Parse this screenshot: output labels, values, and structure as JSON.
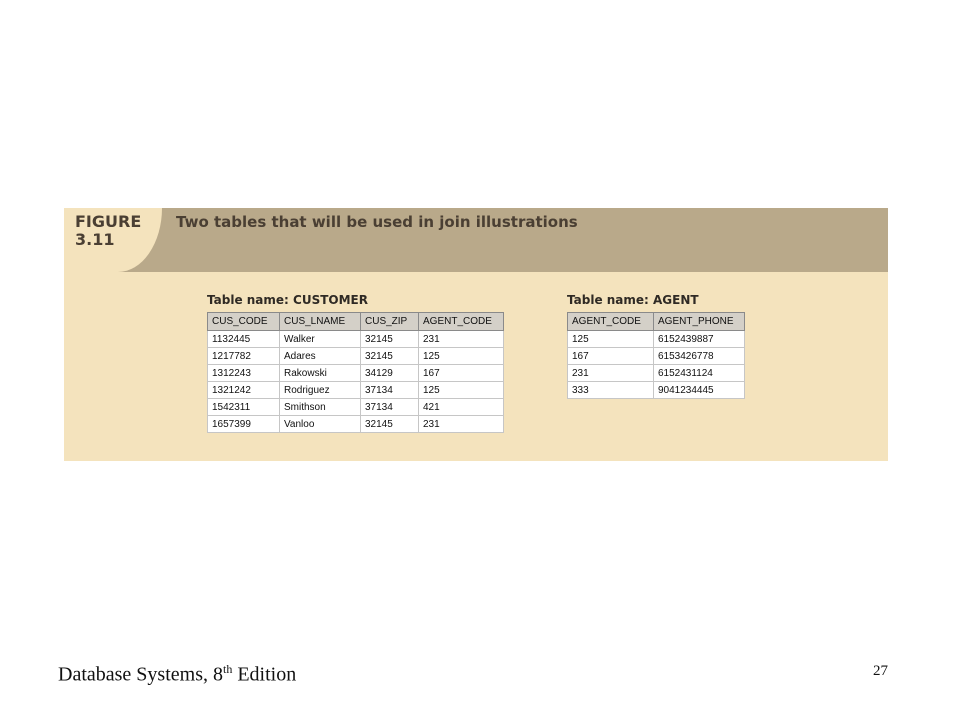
{
  "figure": {
    "label_line1": "FIGURE",
    "label_line2": "3.11",
    "caption": "Two tables that will be used in join illustrations"
  },
  "customer_table": {
    "title": "Table name: CUSTOMER",
    "columns": [
      "CUS_CODE",
      "CUS_LNAME",
      "CUS_ZIP",
      "AGENT_CODE"
    ],
    "rows": [
      [
        "1132445",
        "Walker",
        "32145",
        "231"
      ],
      [
        "1217782",
        "Adares",
        "32145",
        "125"
      ],
      [
        "1312243",
        "Rakowski",
        "34129",
        "167"
      ],
      [
        "1321242",
        "Rodriguez",
        "37134",
        "125"
      ],
      [
        "1542311",
        "Smithson",
        "37134",
        "421"
      ],
      [
        "1657399",
        "Vanloo",
        "32145",
        "231"
      ]
    ]
  },
  "agent_table": {
    "title": "Table name: AGENT",
    "columns": [
      "AGENT_CODE",
      "AGENT_PHONE"
    ],
    "rows": [
      [
        "125",
        "6152439887"
      ],
      [
        "167",
        "6153426778"
      ],
      [
        "231",
        "6152431124"
      ],
      [
        "333",
        "9041234445"
      ]
    ]
  },
  "footer": {
    "book_title_prefix": "Database Systems, 8",
    "book_title_sup": "th",
    "book_title_suffix": " Edition",
    "page_number": "27"
  }
}
